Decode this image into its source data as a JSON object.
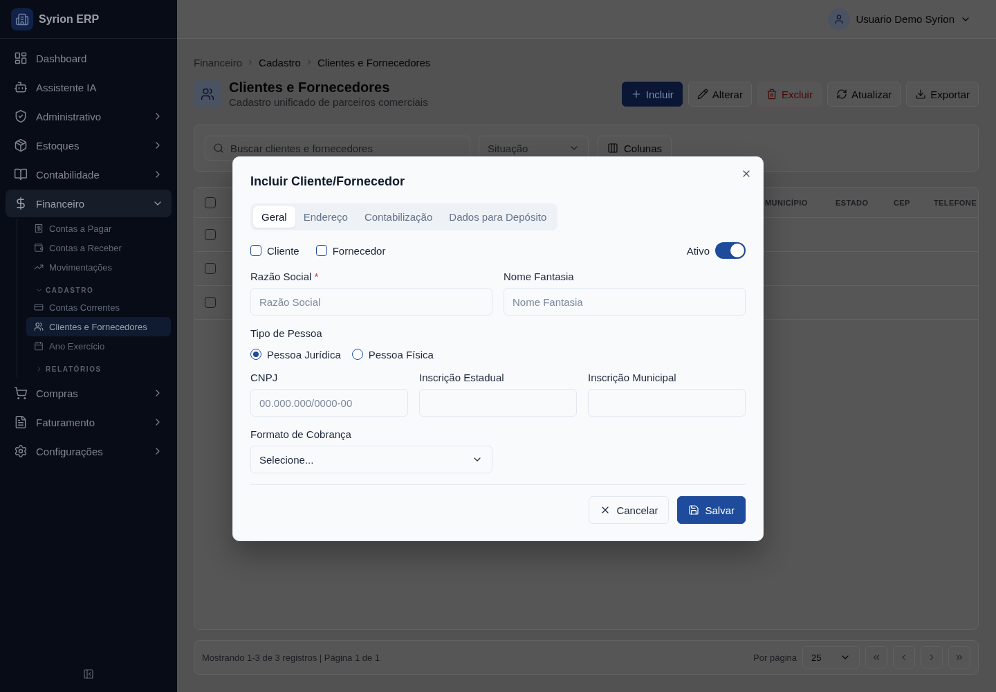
{
  "sidebar": {
    "brand": "Syrion ERP",
    "items": [
      {
        "label": "Dashboard",
        "selected": false
      },
      {
        "label": "Assistente IA",
        "selected": false
      },
      {
        "label": "Administrativo",
        "selected": false,
        "expanded": false
      },
      {
        "label": "Estoques",
        "selected": false,
        "expanded": false
      },
      {
        "label": "Contabilidade",
        "selected": false,
        "expanded": false
      },
      {
        "label": "Financeiro",
        "selected": true,
        "expanded": true,
        "children": [
          {
            "kind": "link",
            "label": "Contas a Pagar",
            "selected": false
          },
          {
            "kind": "link",
            "label": "Contas a Receber",
            "selected": false
          },
          {
            "kind": "link",
            "label": "Movimentações",
            "selected": false
          },
          {
            "kind": "section",
            "label": "CADASTRO",
            "expanded": true,
            "children": [
              {
                "label": "Contas Correntes",
                "selected": false
              },
              {
                "label": "Clientes e Fornecedores",
                "selected": true
              },
              {
                "label": "Ano Exercício",
                "selected": false
              }
            ]
          },
          {
            "kind": "section",
            "label": "RELATÓRIOS",
            "expanded": false
          }
        ]
      },
      {
        "label": "Compras",
        "selected": false,
        "expanded": false
      },
      {
        "label": "Faturamento",
        "selected": false,
        "expanded": false
      },
      {
        "label": "Configurações",
        "selected": false,
        "expanded": false
      }
    ]
  },
  "top_bar": {
    "user_name": "Usuario Demo Syrion"
  },
  "breadcrumb": [
    {
      "label": "Financeiro",
      "kind": "link"
    },
    {
      "label": "Cadastro",
      "kind": "text"
    },
    {
      "label": "Clientes e Fornecedores",
      "kind": "text"
    }
  ],
  "page_header": {
    "title": "Clientes e Fornecedores",
    "subtitle": "Cadastro unificado de parceiros comerciais"
  },
  "actions": [
    {
      "label": "Incluir",
      "kind": "primary"
    },
    {
      "label": "Alterar",
      "kind": "default"
    },
    {
      "label": "Excluir",
      "kind": "danger"
    },
    {
      "label": "Atualizar",
      "kind": "default"
    },
    {
      "label": "Exportar",
      "kind": "default"
    }
  ],
  "filters": {
    "search_placeholder": "Buscar clientes e fornecedores",
    "status_placeholder": "Situação",
    "columns_button": "Colunas"
  },
  "table": {
    "select_all_checked": false,
    "columns": [
      "MUNICÍPIO",
      "ESTADO",
      "CEP",
      "TELEFONE"
    ],
    "rows": [
      {
        "checked": false
      },
      {
        "checked": false
      },
      {
        "checked": false
      }
    ]
  },
  "pagination": {
    "summary": "Mostrando 1-3 de 3 registros | Página 1 de 1",
    "per_page_label": "Por página",
    "per_page": "25"
  },
  "modal": {
    "title": "Incluir Cliente/Fornecedor",
    "tabs": [
      {
        "label": "Geral",
        "selected": true
      },
      {
        "label": "Endereço",
        "selected": false
      },
      {
        "label": "Contabilização",
        "selected": false
      },
      {
        "label": "Dados para Depósito",
        "selected": false
      }
    ],
    "roles": [
      {
        "label": "Cliente",
        "checked": false
      },
      {
        "label": "Fornecedor",
        "checked": false
      }
    ],
    "active": {
      "label": "Ativo",
      "on": true
    },
    "razao_social": {
      "label": "Razão Social",
      "required_mark": "*",
      "placeholder": "Razão Social"
    },
    "nome_fantasia": {
      "label": "Nome Fantasia",
      "placeholder": "Nome Fantasia"
    },
    "tipo_pessoa": {
      "label": "Tipo de Pessoa",
      "options": [
        {
          "label": "Pessoa Jurídica",
          "selected": true
        },
        {
          "label": "Pessoa Física",
          "selected": false
        }
      ]
    },
    "cnpj": {
      "label": "CNPJ",
      "placeholder": "00.000.000/0000-00"
    },
    "inscricao_estadual": {
      "label": "Inscrição Estadual"
    },
    "inscricao_municipal": {
      "label": "Inscrição Municipal"
    },
    "formato_cobranca": {
      "label": "Formato de Cobrança",
      "value": "Selecione..."
    },
    "buttons": [
      {
        "label": "Cancelar",
        "kind": "secondary"
      },
      {
        "label": "Salvar",
        "kind": "primary"
      }
    ]
  }
}
